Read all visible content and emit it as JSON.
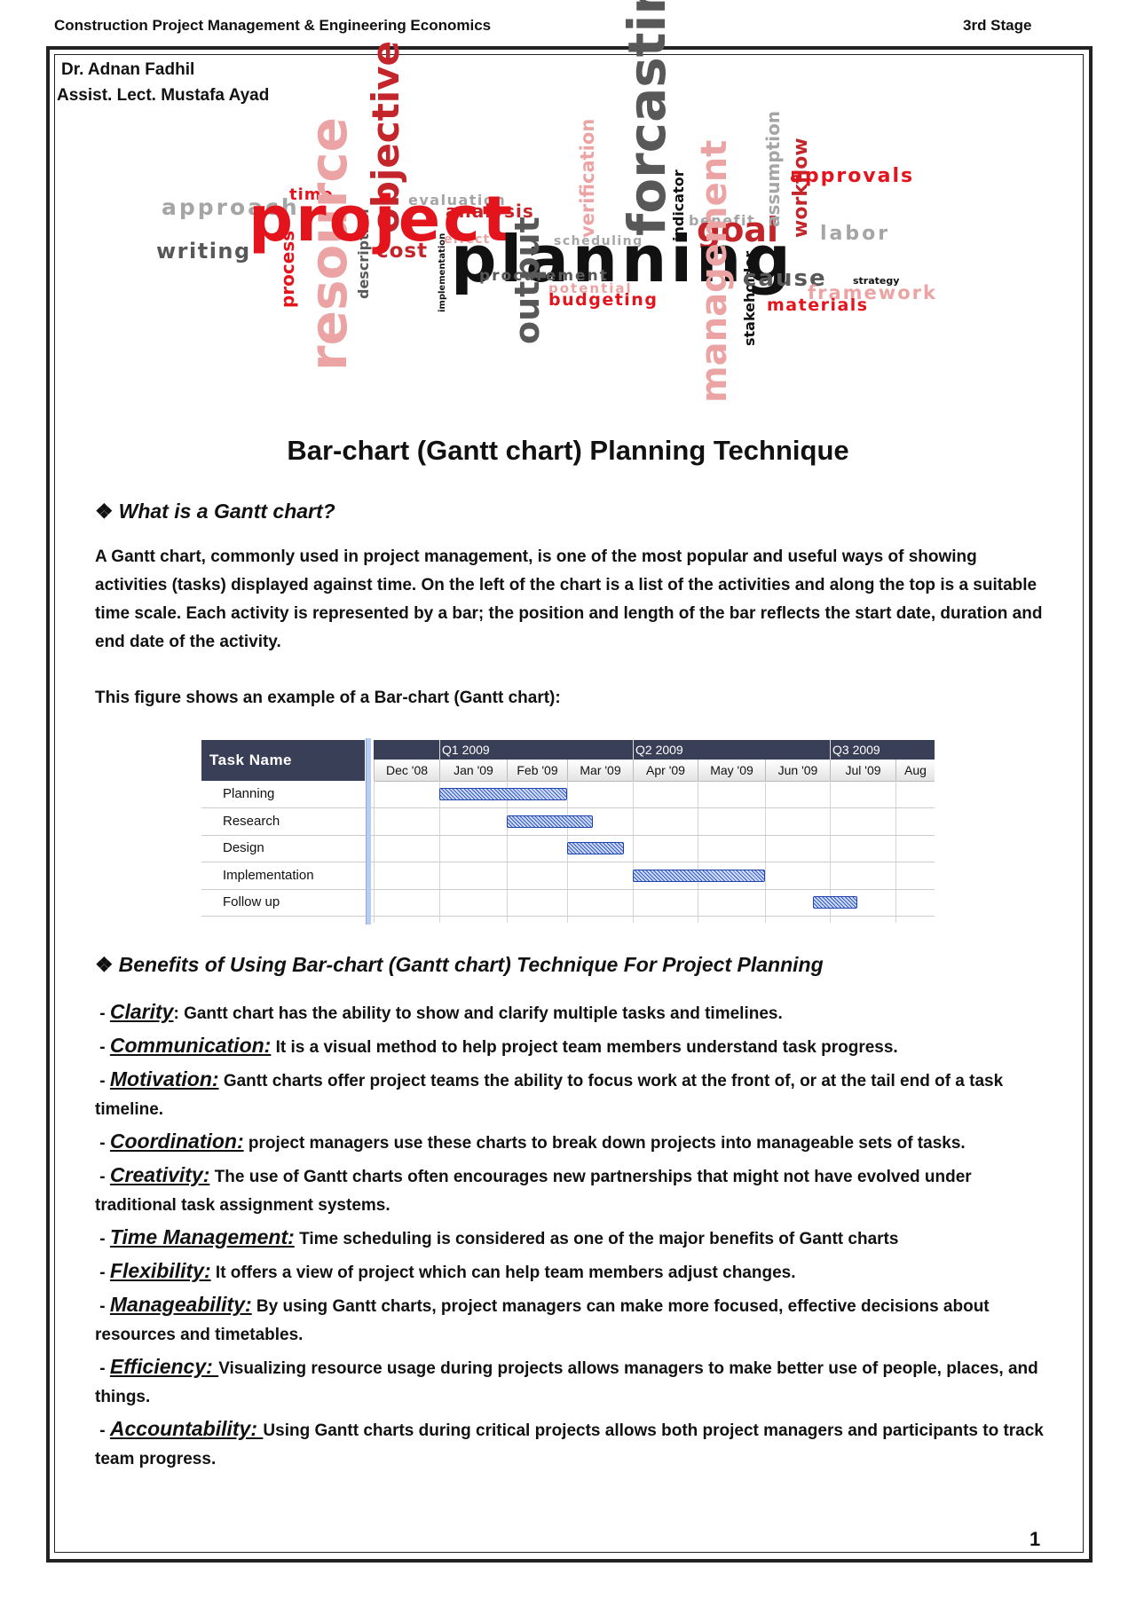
{
  "header": {
    "course": "Construction Project Management & Engineering Economics",
    "stage": "3rd Stage"
  },
  "authors": [
    "Dr. Adnan Fadhil",
    "Assist. Lect. Mustafa Ayad"
  ],
  "word_cloud": [
    "approach",
    "time",
    "objective",
    "evaluation",
    "analysis",
    "verification",
    "forcasting",
    "indicator",
    "benefit",
    "goal",
    "assumption",
    "workflow",
    "approvals",
    "labor",
    "writing",
    "resource",
    "process",
    "description",
    "cost",
    "effect",
    "scheduling",
    "project",
    "planning",
    "implementation",
    "procurement",
    "potential",
    "budgeting",
    "output",
    "management",
    "stakeholder",
    "cause",
    "strategy",
    "framework",
    "materials"
  ],
  "title": "Bar-chart (Gantt chart) Planning Technique",
  "section1": {
    "diamond": "❖",
    "heading": "What is a Gantt chart?",
    "paragraph": "A Gantt chart, commonly used in project management, is one of the most popular and useful ways of showing activities (tasks) displayed against time. On the left of the chart is a list of the activities and along the top is a suitable time scale. Each activity is represented by a bar; the position and length of the bar reflects the start date, duration and end date of the activity.",
    "figure_intro": "This figure shows an example of a Bar-chart (Gantt chart):"
  },
  "chart_data": {
    "type": "gantt",
    "task_header": "Task Name",
    "quarters": [
      "Q1 2009",
      "Q2 2009",
      "Q3 2009"
    ],
    "months": [
      "Dec '08",
      "Jan '09",
      "Feb '09",
      "Mar '09",
      "Apr '09",
      "May '09",
      "Jun '09",
      "Jul '09",
      "Aug"
    ],
    "tasks": [
      {
        "name": "Planning",
        "start": "2009-01-01",
        "end": "2009-02-28"
      },
      {
        "name": "Research",
        "start": "2009-02-01",
        "end": "2009-03-12"
      },
      {
        "name": "Design",
        "start": "2009-03-01",
        "end": "2009-03-27"
      },
      {
        "name": "Implementation",
        "start": "2009-04-01",
        "end": "2009-05-31"
      },
      {
        "name": "Follow up",
        "start": "2009-06-23",
        "end": "2009-07-13"
      }
    ],
    "colors": {
      "header": "#3a3f58",
      "bar": "#1f43b0"
    }
  },
  "section2": {
    "diamond": "❖",
    "heading": "Benefits of Using Bar-chart (Gantt chart) Technique For Project Planning",
    "items": [
      {
        "term": "Clarity",
        "text": ": Gantt chart has the ability to show and clarify multiple tasks and timelines."
      },
      {
        "term": "Communication:",
        "text": " It is a visual method to help project team members understand task progress."
      },
      {
        "term": "Motivation:",
        "text": " Gantt charts offer project teams the ability to focus work at the front of, or at the tail end of a task timeline."
      },
      {
        "term": "Coordination:",
        "text": " project managers use these charts to break down projects into manageable sets of tasks."
      },
      {
        "term": "Creativity:",
        "text": " The use of Gantt charts often encourages new partnerships that might not have evolved under traditional task assignment systems."
      },
      {
        "term": "Time Management:",
        "text": " Time scheduling is considered as one of the major benefits of Gantt charts"
      },
      {
        "term": "Flexibility:",
        "text": " It offers a view of project which can help team members adjust changes."
      },
      {
        "term": "Manageability:",
        "text": " By using Gantt charts, project managers can make more focused, effective decisions about resources and timetables."
      },
      {
        "term": "Efficiency: ",
        "text": "Visualizing resource usage during projects allows managers to make better use of people, places, and things."
      },
      {
        "term": "Accountability: ",
        "text": "Using Gantt charts during critical projects allows both project managers and participants to track team progress."
      }
    ]
  },
  "page_number": "1"
}
